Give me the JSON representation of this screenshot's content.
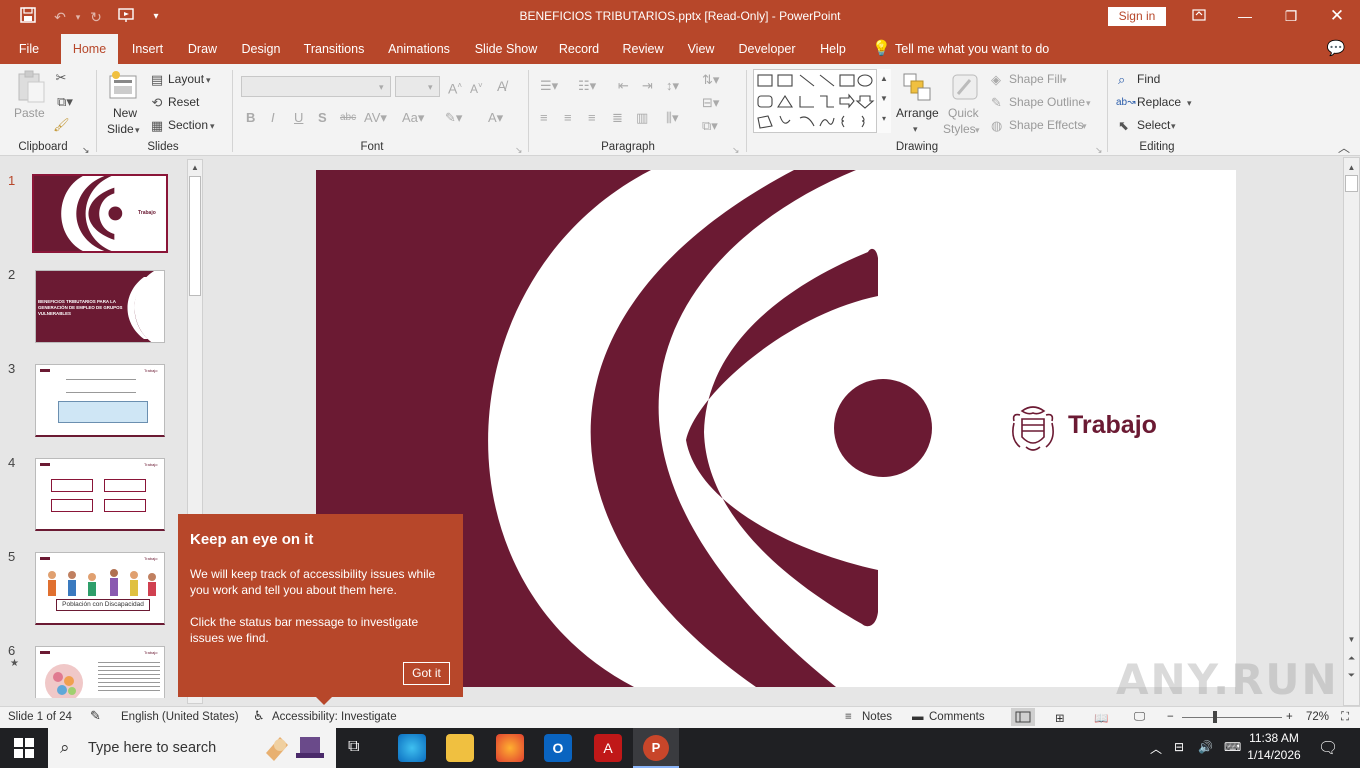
{
  "window": {
    "title": "BENEFICIOS TRIBUTARIOS.pptx [Read-Only]  -  PowerPoint",
    "sign_in": "Sign in"
  },
  "tabs": [
    "File",
    "Home",
    "Insert",
    "Draw",
    "Design",
    "Transitions",
    "Animations",
    "Slide Show",
    "Record",
    "Review",
    "View",
    "Developer",
    "Help"
  ],
  "tell_me": "Tell me what you want to do",
  "ribbon": {
    "clipboard": {
      "label": "Clipboard",
      "paste": "Paste"
    },
    "slides": {
      "label": "Slides",
      "new_slide": "New",
      "new_slide2": "Slide",
      "layout": "Layout",
      "reset": "Reset",
      "section": "Section"
    },
    "font": {
      "label": "Font"
    },
    "paragraph": {
      "label": "Paragraph"
    },
    "drawing": {
      "label": "Drawing",
      "arrange": "Arrange",
      "quick": "Quick",
      "styles": "Styles",
      "shape_fill": "Shape Fill",
      "shape_outline": "Shape Outline",
      "shape_effects": "Shape Effects"
    },
    "editing": {
      "label": "Editing",
      "find": "Find",
      "replace": "Replace",
      "select": "Select"
    }
  },
  "thumbnails": {
    "nums": [
      "1",
      "2",
      "3",
      "4",
      "5",
      "6"
    ],
    "slide2_text": "BENEFICIOS TRIBUTARIOS PARA LA GENERACIÓN DE EMPLEO DE GRUPOS VULNERABLES",
    "slide5_label": "Población con Discapacidad",
    "brand_small": "Trabajo"
  },
  "slide": {
    "brand": "Trabajo",
    "color": "#6b1a33"
  },
  "tooltip": {
    "title": "Keep an eye on it",
    "body1": "We will keep track of accessibility issues while you work and tell you about them here.",
    "body2": "Click the status bar message to investigate issues we find.",
    "button": "Got it"
  },
  "status": {
    "slide_info": "Slide 1 of 24",
    "language": "English (United States)",
    "accessibility": "Accessibility: Investigate",
    "notes": "Notes",
    "comments": "Comments",
    "zoom": "72%"
  },
  "taskbar": {
    "search_placeholder": "Type here to search",
    "time": "11:38 AM",
    "date": "1/14/2026"
  },
  "watermark": "ANY.RUN",
  "colors": {
    "accent": "#b7472a",
    "brand": "#6b1a33"
  }
}
